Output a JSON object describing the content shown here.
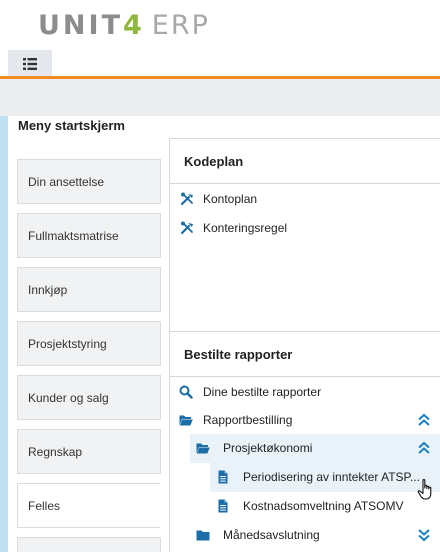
{
  "brand": {
    "unit": "UNIT",
    "four": "4",
    "erp": "ERP"
  },
  "header": {
    "menu_icon": "list-icon",
    "accent_color": "#f08a24"
  },
  "page_title": "Meny startskjerm",
  "nav_items": [
    {
      "label": "Din ansettelse"
    },
    {
      "label": "Fullmaktsmatrise"
    },
    {
      "label": "Innkjøp"
    },
    {
      "label": "Prosjektstyring"
    },
    {
      "label": "Kunder og salg"
    },
    {
      "label": "Regnskap"
    },
    {
      "label": "Felles"
    }
  ],
  "kodeplan": {
    "title": "Kodeplan",
    "items": [
      {
        "label": "Kontoplan",
        "icon": "tools-icon"
      },
      {
        "label": "Konteringsregel",
        "icon": "tools-icon"
      }
    ]
  },
  "reports": {
    "title": "Bestilte rapporter",
    "items": [
      {
        "label": "Dine bestilte rapporter",
        "icon": "search-icon"
      },
      {
        "label": "Rapportbestilling",
        "icon": "folder-open-icon",
        "chevron": "chevron-up-icon"
      },
      {
        "label": "Prosjektøkonomi",
        "icon": "folder-open-icon",
        "chevron": "chevron-up-icon"
      },
      {
        "label": "Periodisering av inntekter ATSP...",
        "icon": "document-icon"
      },
      {
        "label": "Kostnadsomveltning ATSOMV",
        "icon": "document-icon"
      },
      {
        "label": "Månedsavslutning",
        "icon": "folder-icon",
        "chevron": "chevron-down-icon"
      }
    ]
  },
  "colors": {
    "icon_blue": "#1b6ea8",
    "highlight": "#e9f2f8",
    "chevron_blue": "#1b7fc4",
    "brand_green": "#8fb83e"
  }
}
